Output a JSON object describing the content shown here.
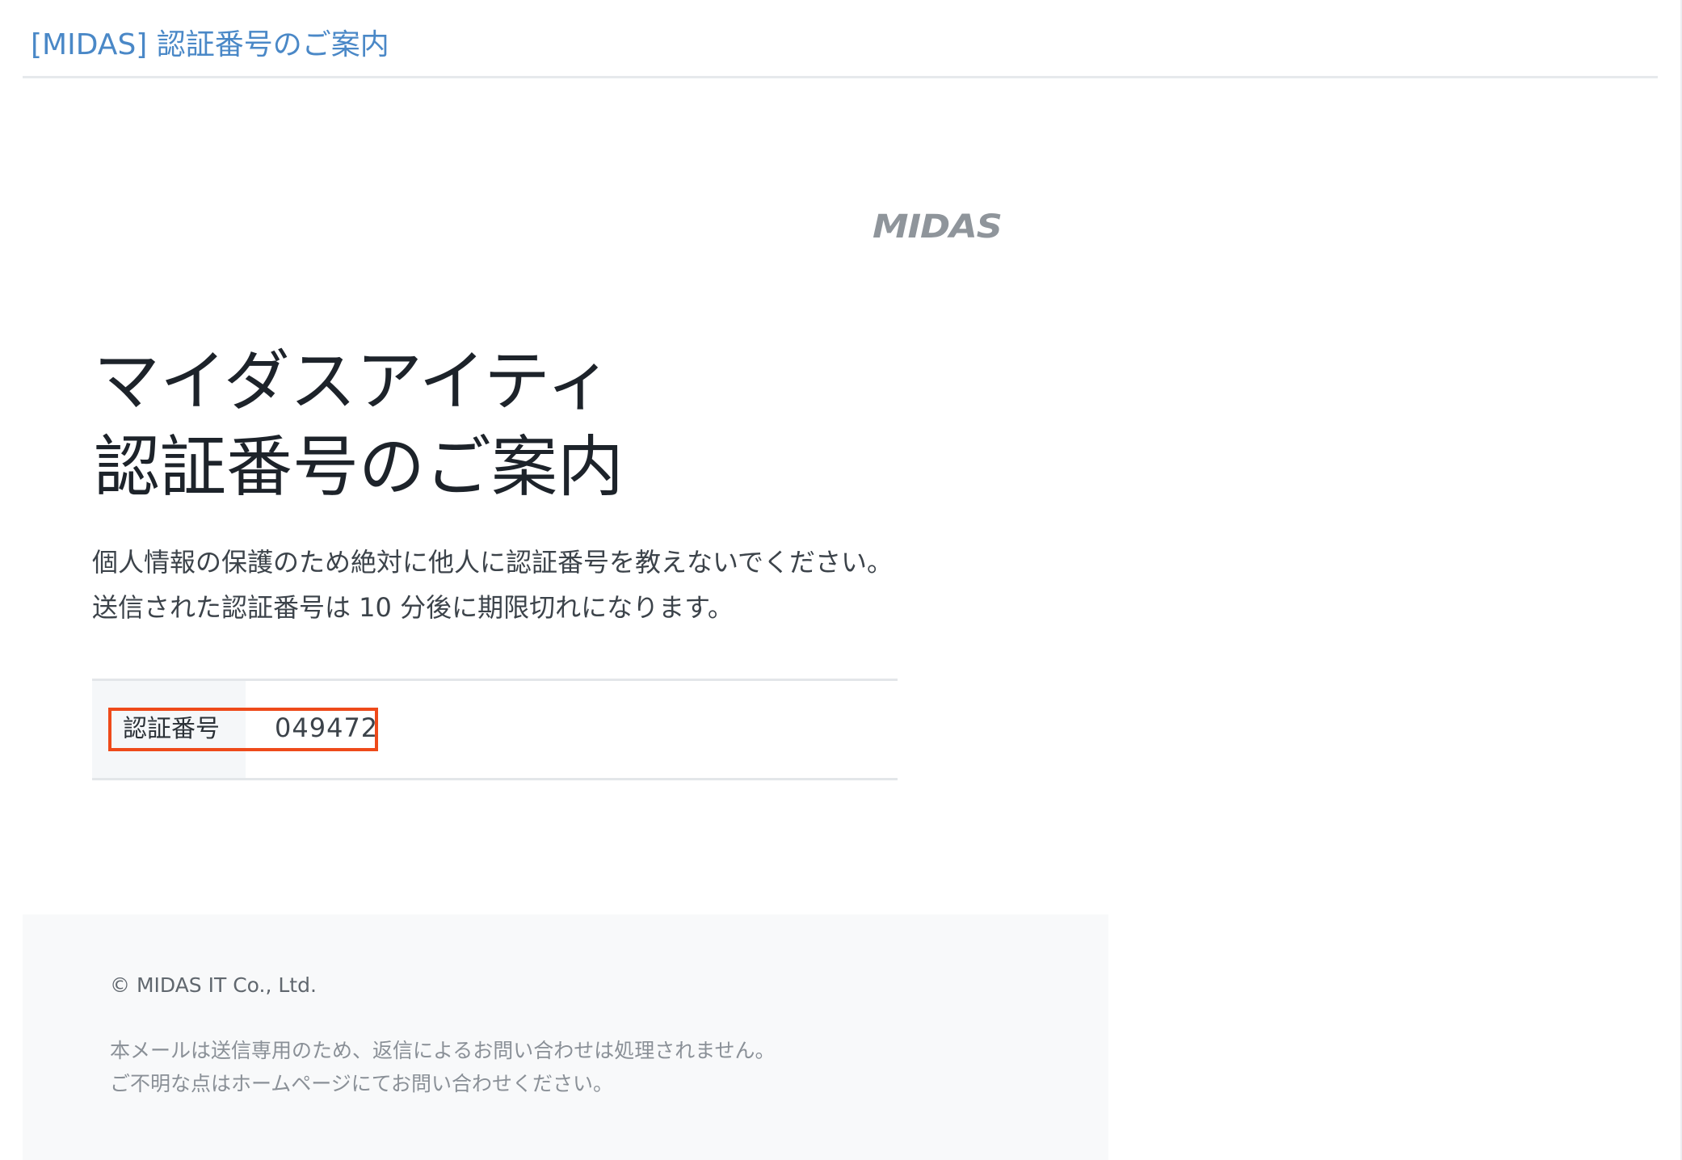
{
  "email": {
    "subject": "[MIDAS] 認証番号のご案内"
  },
  "logo": {
    "text": "MIDAS",
    "color": "#8f959b"
  },
  "heading": {
    "line1": "マイダスアイティ",
    "line2": "認証番号のご案内"
  },
  "notice": {
    "line1": "個人情報の保護のため絶対に他人に認証番号を教えないでください。",
    "line2": "送信された認証番号は 10 分後に期限切れになります。"
  },
  "verification": {
    "label": "認証番号",
    "code": "049472",
    "highlight_color": "#ee4a1a"
  },
  "footer": {
    "copyright": "© MIDAS IT Co., Ltd.",
    "note_line1": "本メールは送信専用のため、返信によるお問い合わせは処理されません。",
    "note_line2": "ご不明な点はホームページにてお問い合わせください。"
  },
  "colors": {
    "subject": "#4a88c7",
    "heading": "#1d232a",
    "footer_bg": "#f8f9fa"
  }
}
